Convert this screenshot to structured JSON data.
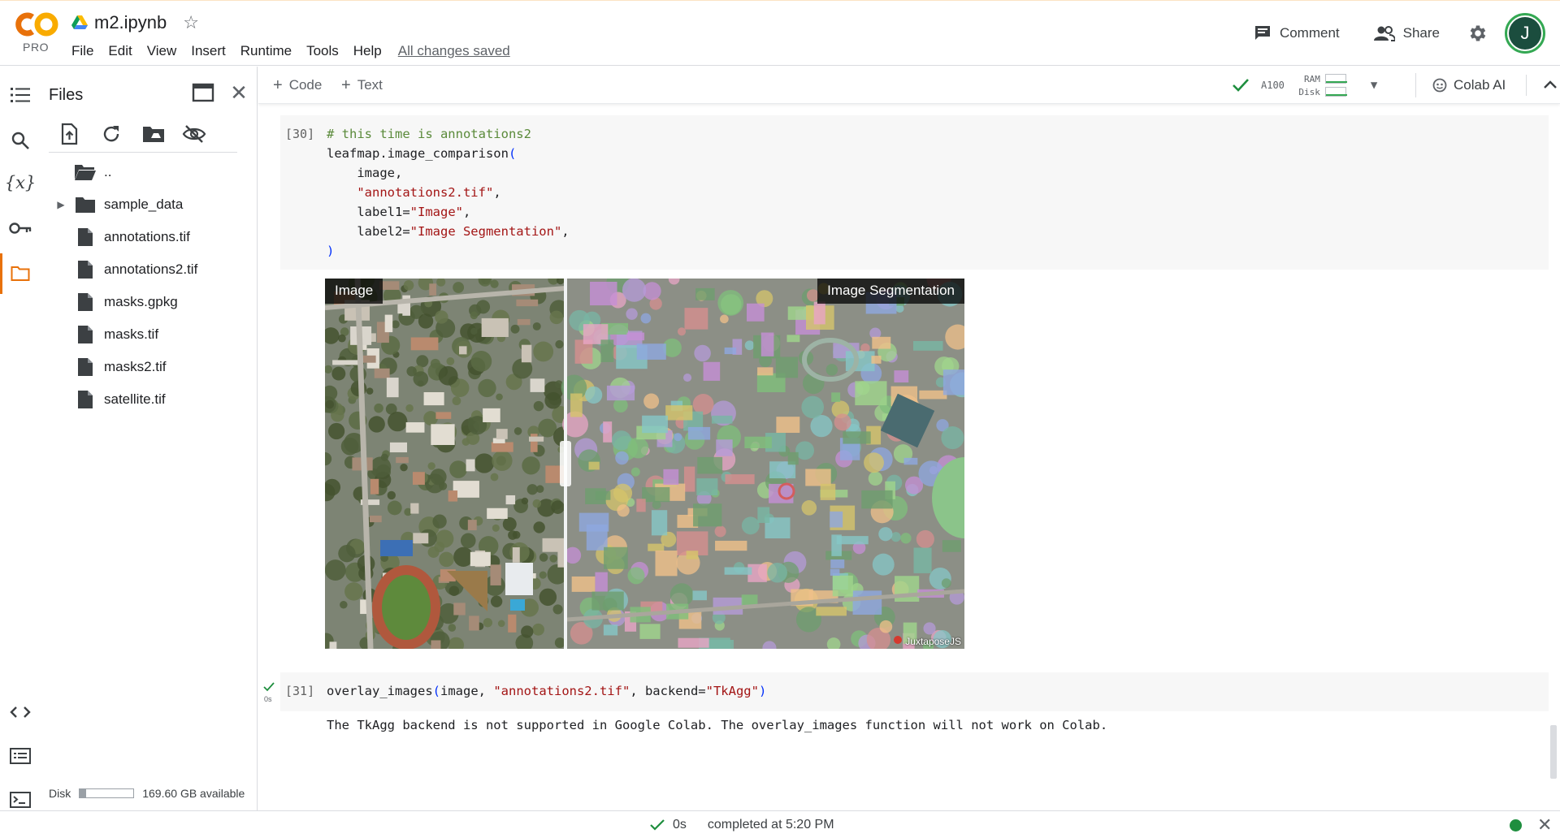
{
  "header": {
    "logo_text": "CO",
    "logo_badge": "PRO",
    "notebook_title": "m2.ipynb",
    "menu": [
      "File",
      "Edit",
      "View",
      "Insert",
      "Runtime",
      "Tools",
      "Help"
    ],
    "save_status": "All changes saved",
    "comment_label": "Comment",
    "share_label": "Share",
    "avatar_initial": "J"
  },
  "files_panel": {
    "title": "Files",
    "parent_dir": "..",
    "items": [
      {
        "name": "sample_data",
        "type": "folder"
      },
      {
        "name": "annotations.tif",
        "type": "file"
      },
      {
        "name": "annotations2.tif",
        "type": "file"
      },
      {
        "name": "masks.gpkg",
        "type": "file"
      },
      {
        "name": "masks.tif",
        "type": "file"
      },
      {
        "name": "masks2.tif",
        "type": "file"
      },
      {
        "name": "satellite.tif",
        "type": "file"
      }
    ],
    "disk_label": "Disk",
    "disk_available": "169.60 GB available",
    "disk_used_fraction": 0.12
  },
  "toolbar": {
    "add_code": "Code",
    "add_text": "Text",
    "gpu": "A100",
    "ram_label": "RAM",
    "disk_label": "Disk",
    "colab_ai": "Colab AI"
  },
  "cells": [
    {
      "exec_count": "[30]",
      "code_lines": [
        [
          [
            "cm",
            "# this time is annotations2"
          ]
        ],
        [
          [
            "pl",
            "leafmap.image_comparison"
          ],
          [
            "par",
            "("
          ]
        ],
        [
          [
            "pl",
            "    image,"
          ]
        ],
        [
          [
            "pl",
            "    "
          ],
          [
            "str",
            "\"annotations2.tif\""
          ],
          [
            "pl",
            ","
          ]
        ],
        [
          [
            "pl",
            "    label1="
          ],
          [
            "str",
            "\"Image\""
          ],
          [
            "pl",
            ","
          ]
        ],
        [
          [
            "pl",
            "    label2="
          ],
          [
            "str",
            "\"Image Segmentation\""
          ],
          [
            "pl",
            ","
          ]
        ],
        [
          [
            "par",
            ")"
          ]
        ]
      ],
      "output": {
        "label_left": "Image",
        "label_right": "Image Segmentation",
        "credit": "JuxtaposeJS"
      }
    },
    {
      "exec_count": "[31]",
      "run_time": "0s",
      "code_lines": [
        [
          [
            "pl",
            "overlay_images"
          ],
          [
            "par",
            "("
          ],
          [
            "pl",
            "image, "
          ],
          [
            "str",
            "\"annotations2.tif\""
          ],
          [
            "pl",
            ", backend="
          ],
          [
            "str",
            "\"TkAgg\""
          ],
          [
            "par",
            ")"
          ]
        ]
      ],
      "output_text": "The TkAgg backend is not supported in Google Colab. The overlay_images function will not work on Colab."
    }
  ],
  "statusbar": {
    "elapsed": "0s",
    "completed": "completed at 5:20 PM"
  },
  "colors": {
    "accent_orange": "#e8710a",
    "logo_yellow": "#f9ab00",
    "status_green": "#1e8e3e"
  }
}
